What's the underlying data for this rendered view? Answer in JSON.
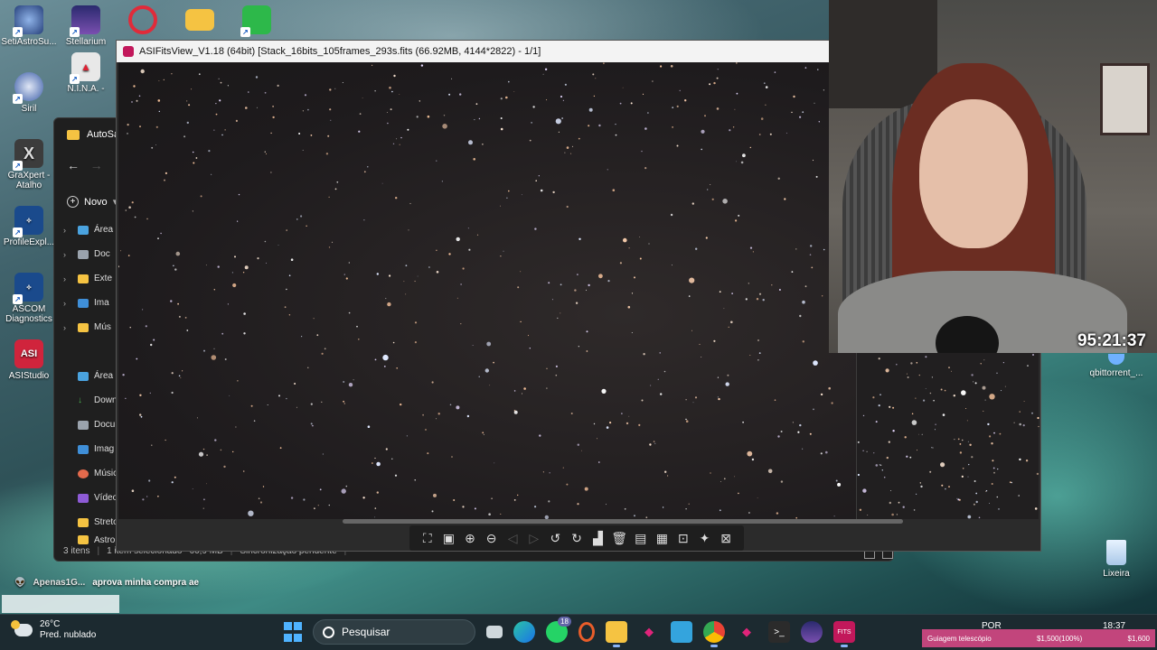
{
  "desktop": {
    "icons": [
      {
        "label": "SetiAstroSu..."
      },
      {
        "label": "Stellarium"
      },
      {
        "label": "Siril"
      },
      {
        "label": "N.I.N.A. -"
      },
      {
        "label": "GraXpert - Atalho"
      },
      {
        "label": "ProfileExpl..."
      },
      {
        "label": "ASCOM Diagnostics"
      },
      {
        "label": "ASIStudio"
      },
      {
        "label": "qbittorrent_..."
      },
      {
        "label": "Lixeira"
      }
    ]
  },
  "explorer": {
    "title": "AutoSa",
    "new_label": "Novo",
    "sidebar": [
      {
        "label": "Área",
        "chev": "›"
      },
      {
        "label": "Doc",
        "chev": "›"
      },
      {
        "label": "Exte",
        "chev": "›"
      },
      {
        "label": "Ima",
        "chev": "›"
      },
      {
        "label": "Mús",
        "chev": "›"
      },
      {
        "label": "",
        "chev": ""
      },
      {
        "label": "Área",
        "chev": ""
      },
      {
        "label": "Down",
        "chev": ""
      },
      {
        "label": "Docu",
        "chev": ""
      },
      {
        "label": "Imag",
        "chev": ""
      },
      {
        "label": "Músic",
        "chev": ""
      },
      {
        "label": "Vídeo",
        "chev": ""
      },
      {
        "label": "Streto",
        "chev": ""
      },
      {
        "label": "Astro",
        "chev": ""
      }
    ],
    "status": {
      "items": "3 itens",
      "selected": "1 item selecionado",
      "size": "66,9 MB",
      "sync": "Sincronização pendente"
    }
  },
  "viewer": {
    "title": "ASIFitsView_V1.18 (64bit) [Stack_16bits_105frames_293s.fits (66.92MB, 4144*2822) - 1/1]",
    "toolbar": [
      "fit-icon",
      "crop-icon",
      "zoom-in-icon",
      "zoom-out-icon",
      "prev-icon",
      "next-icon",
      "rotate-left-icon",
      "rotate-right-icon",
      "histogram-icon",
      "delete-icon",
      "save-icon",
      "image-info-icon",
      "one-to-one-icon",
      "star-icon",
      "settings-icon"
    ]
  },
  "webcam": {
    "timer": "95:21:37"
  },
  "chat": {
    "user": "Apenas1G...",
    "message": "aprova minha compra ae"
  },
  "taskbar": {
    "weather_temp": "26°C",
    "weather_desc": "Pred. nublado",
    "search_placeholder": "Pesquisar",
    "whatsapp_badge": "18",
    "language": "POR",
    "time": "18:37",
    "guidance_label": "Guiagem telescópio",
    "guidance_value": "$1,500(100%)",
    "guidance_total": "$1,600"
  },
  "colors": {
    "accent": "#c2457c",
    "viewer_bg": "#2b2b2b",
    "taskbar_bg": "#1c2a30"
  }
}
